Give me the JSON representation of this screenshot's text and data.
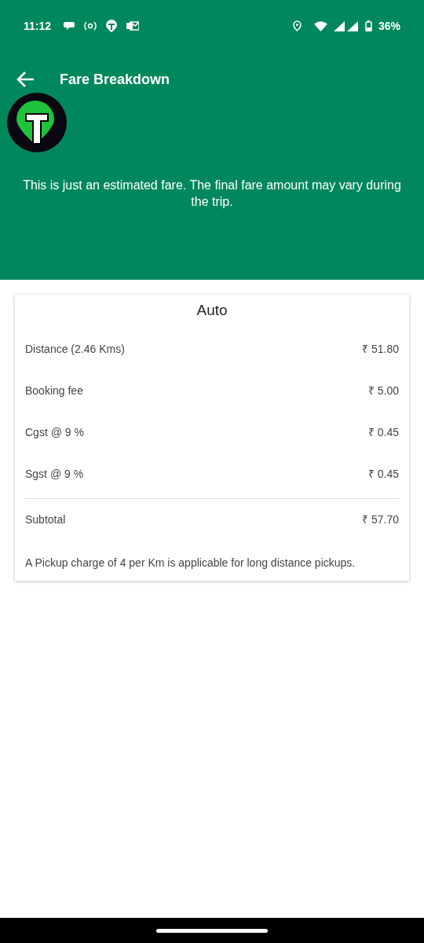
{
  "status_bar": {
    "time": "11:12",
    "battery": "36%"
  },
  "toolbar": {
    "title": "Fare Breakdown"
  },
  "notice": "This is just an estimated fare. The final fare amount may vary during the trip.",
  "fare_card": {
    "title": "Auto",
    "rows": [
      {
        "label": "Distance (2.46 Kms)",
        "amount": "₹ 51.80"
      },
      {
        "label": "Booking fee",
        "amount": "₹ 5.00"
      },
      {
        "label": "Cgst @ 9 %",
        "amount": "₹ 0.45"
      },
      {
        "label": "Sgst @ 9 %",
        "amount": "₹ 0.45"
      }
    ],
    "subtotal": {
      "label": "Subtotal",
      "amount": "₹ 57.70"
    },
    "note": "A Pickup charge of 4 per Km is applicable for long distance pickups."
  }
}
